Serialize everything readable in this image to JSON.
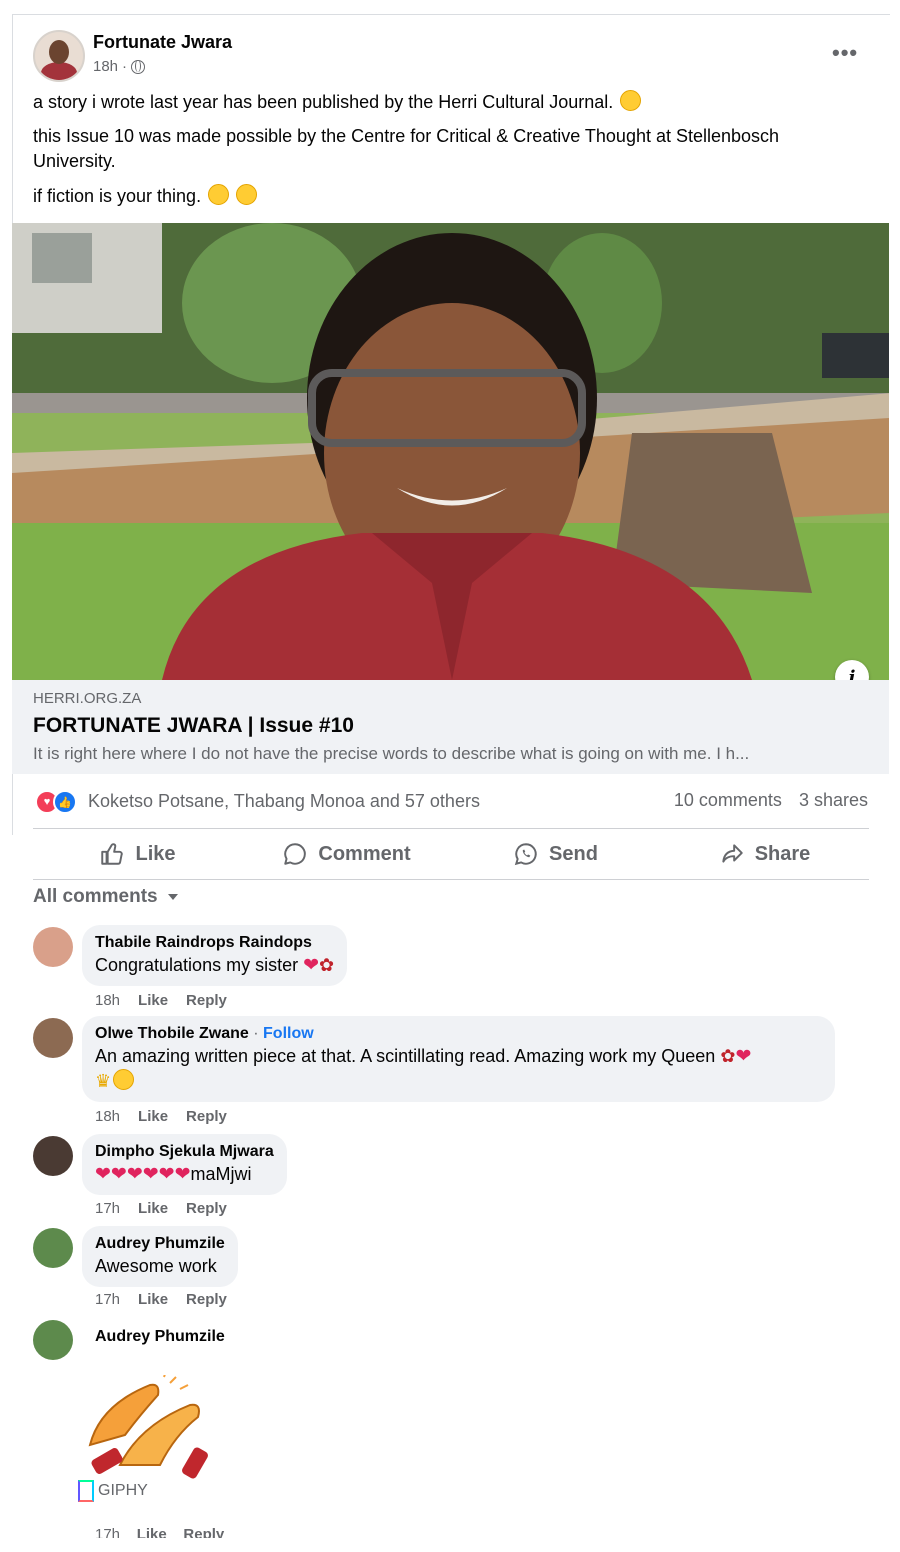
{
  "post": {
    "author": "Fortunate Jwara",
    "time": "18h",
    "visibility_icon": "globe-icon",
    "more_icon": "more-dots-icon",
    "paragraphs": [
      "a story i wrote last year has been published by the Herri Cultural Journal.",
      "this Issue 10 was made possible by the Centre for Critical & Creative Thought at Stellenbosch University.",
      "if fiction is your thing."
    ],
    "link": {
      "domain": "HERRI.ORG.ZA",
      "title": "FORTUNATE JWARA | Issue #10",
      "description": "It is right here where I do not have the precise words to describe what is going on with me. I h..."
    },
    "reactions": {
      "icons": [
        "love-reaction-icon",
        "like-reaction-icon"
      ],
      "names": "Koketso Potsane, Thabang Monoa and 57 others",
      "comments": "10 comments",
      "shares": "3 shares"
    },
    "actions": {
      "like": "Like",
      "comment": "Comment",
      "send": "Send",
      "share": "Share"
    }
  },
  "comments_filter": "All comments",
  "comments": [
    {
      "name": "Thabile Raindrops Raindops",
      "text": "Congratulations my sister",
      "time": "18h",
      "like": "Like",
      "reply": "Reply"
    },
    {
      "name": "Olwe Thobile Zwane",
      "follow": "Follow",
      "text": "An amazing written piece at that. A scintillating read. Amazing work my Queen",
      "time": "18h",
      "like": "Like",
      "reply": "Reply"
    },
    {
      "name": "Dimpho Sjekula Mjwara",
      "text": "maMjwi",
      "time": "17h",
      "like": "Like",
      "reply": "Reply"
    },
    {
      "name": "Audrey Phumzile",
      "text": "Awesome work",
      "time": "17h",
      "like": "Like",
      "reply": "Reply"
    },
    {
      "name": "Audrey Phumzile",
      "gif_label": "GIPHY",
      "time": "17h",
      "like": "Like",
      "reply": "Reply"
    }
  ],
  "colors": {
    "accent": "#1877f2",
    "love": "#f33e58",
    "muted": "#65676b",
    "bubble": "#f0f2f5"
  }
}
